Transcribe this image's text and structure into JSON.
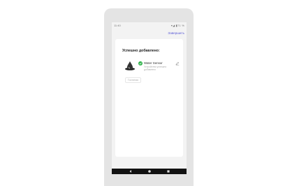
{
  "status": {
    "time": "11:40",
    "icons_text": "▾◢ ▮71 %"
  },
  "header": {
    "finish_label": "Завершить"
  },
  "card": {
    "title": "Успешно добавлено:",
    "device": {
      "name": "Water Sensor",
      "subtitle": "Устройство успешно добавлено",
      "icon": "water-drop-sensor-icon",
      "status_icon": "check-icon"
    },
    "room_chip": "Гостиная"
  },
  "navbar": {
    "back": "back-icon",
    "home": "home-icon",
    "recents": "recents-icon"
  },
  "colors": {
    "accent": "#5b5bd6",
    "success": "#2fb34a",
    "navbar": "#111111"
  }
}
